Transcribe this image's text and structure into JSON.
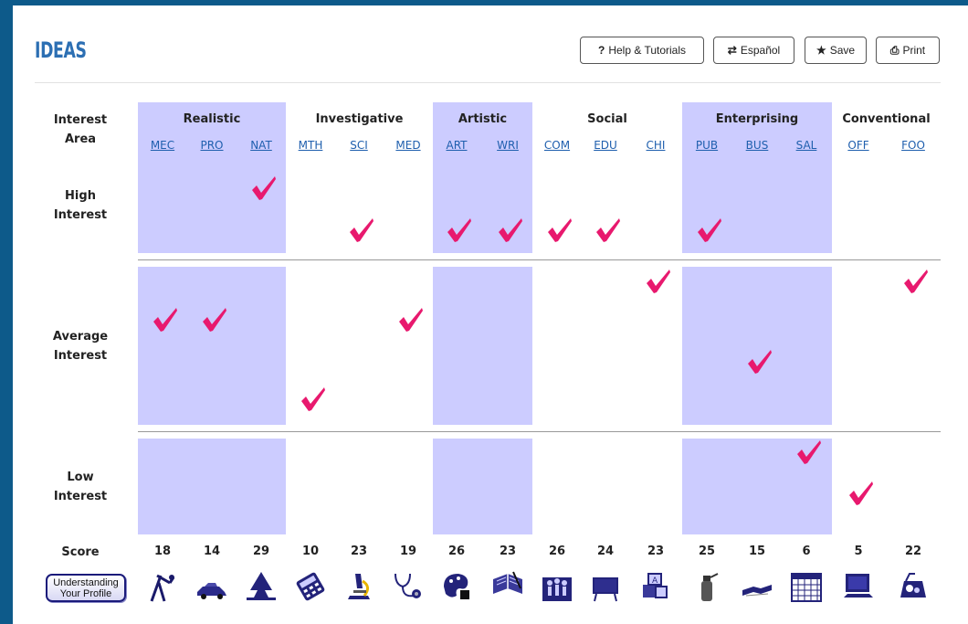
{
  "page_title": "IDEAS",
  "buttons": {
    "help": {
      "icon": "?",
      "label": "Help & Tutorials"
    },
    "espanol": {
      "icon": "⇄",
      "label": "Español"
    },
    "save": {
      "icon": "★",
      "label": "Save"
    },
    "print": {
      "icon": "⎙",
      "label": "Print"
    }
  },
  "row_labels": {
    "interest_area": [
      "Interest",
      "Area"
    ],
    "high": [
      "High",
      "Interest"
    ],
    "average": [
      "Average",
      "Interest"
    ],
    "low": [
      "Low",
      "Interest"
    ],
    "score": "Score"
  },
  "areas": [
    {
      "name": "Realistic",
      "shaded": true
    },
    {
      "name": "Investigative",
      "shaded": false
    },
    {
      "name": "Artistic",
      "shaded": true
    },
    {
      "name": "Social",
      "shaded": false
    },
    {
      "name": "Enterprising",
      "shaded": true
    },
    {
      "name": "Conventional",
      "shaded": false
    }
  ],
  "scales": [
    {
      "code": "MEC",
      "score": "18",
      "level": "average",
      "icon": "tools-icon"
    },
    {
      "code": "PRO",
      "score": "14",
      "level": "average",
      "icon": "car-icon"
    },
    {
      "code": "NAT",
      "score": "29",
      "level": "high",
      "icon": "tree-icon"
    },
    {
      "code": "MTH",
      "score": "10",
      "level": "average",
      "icon": "calculator-icon"
    },
    {
      "code": "SCI",
      "score": "23",
      "level": "high",
      "icon": "microscope-icon"
    },
    {
      "code": "MED",
      "score": "19",
      "level": "average",
      "icon": "stethoscope-icon"
    },
    {
      "code": "ART",
      "score": "26",
      "level": "high",
      "icon": "palette-icon"
    },
    {
      "code": "WRI",
      "score": "23",
      "level": "high",
      "icon": "book-icon"
    },
    {
      "code": "COM",
      "score": "26",
      "level": "high",
      "icon": "community-icon"
    },
    {
      "code": "EDU",
      "score": "24",
      "level": "high",
      "icon": "chalkboard-icon"
    },
    {
      "code": "CHI",
      "score": "23",
      "level": "average",
      "icon": "blocks-icon"
    },
    {
      "code": "PUB",
      "score": "25",
      "level": "high",
      "icon": "fire-extinguisher-icon"
    },
    {
      "code": "BUS",
      "score": "15",
      "level": "average",
      "icon": "handshake-icon"
    },
    {
      "code": "SAL",
      "score": "6",
      "level": "low",
      "icon": "calendar-icon"
    },
    {
      "code": "OFF",
      "score": "5",
      "level": "low",
      "icon": "computer-icon"
    },
    {
      "code": "FOO",
      "score": "22",
      "level": "average",
      "icon": "food-icon"
    }
  ],
  "understanding_button": [
    "Understanding",
    "Your Profile"
  ],
  "colors": {
    "band": "#ccccff",
    "check": "#e8196e",
    "link": "#1f5fae",
    "title": "#2c6fb3",
    "frame": "#0d5a8a"
  }
}
